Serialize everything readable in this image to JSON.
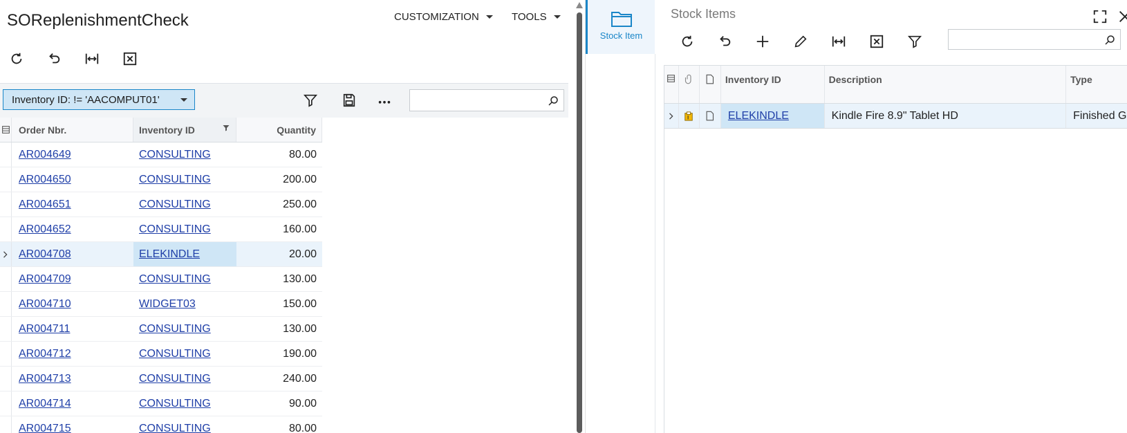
{
  "left": {
    "title": "SOReplenishmentCheck",
    "menus": {
      "customization": "CUSTOMIZATION",
      "tools": "TOOLS"
    },
    "toolbar_icons": [
      "refresh-icon",
      "undo-icon",
      "fit-columns-icon",
      "excel-export-icon"
    ],
    "filter": {
      "chip_label": "Inventory ID: != 'AACOMPUT01'"
    },
    "grid": {
      "columns": {
        "order_nbr": "Order Nbr.",
        "inventory_id": "Inventory ID",
        "quantity": "Quantity"
      },
      "rows": [
        {
          "order_nbr": "AR004649",
          "inventory_id": "CONSULTING",
          "quantity": "80.00"
        },
        {
          "order_nbr": "AR004650",
          "inventory_id": "CONSULTING",
          "quantity": "200.00"
        },
        {
          "order_nbr": "AR004651",
          "inventory_id": "CONSULTING",
          "quantity": "250.00"
        },
        {
          "order_nbr": "AR004652",
          "inventory_id": "CONSULTING",
          "quantity": "160.00"
        },
        {
          "order_nbr": "AR004708",
          "inventory_id": "ELEKINDLE",
          "quantity": "20.00"
        },
        {
          "order_nbr": "AR004709",
          "inventory_id": "CONSULTING",
          "quantity": "130.00"
        },
        {
          "order_nbr": "AR004710",
          "inventory_id": "WIDGET03",
          "quantity": "150.00"
        },
        {
          "order_nbr": "AR004711",
          "inventory_id": "CONSULTING",
          "quantity": "130.00"
        },
        {
          "order_nbr": "AR004712",
          "inventory_id": "CONSULTING",
          "quantity": "190.00"
        },
        {
          "order_nbr": "AR004713",
          "inventory_id": "CONSULTING",
          "quantity": "240.00"
        },
        {
          "order_nbr": "AR004714",
          "inventory_id": "CONSULTING",
          "quantity": "90.00"
        },
        {
          "order_nbr": "AR004715",
          "inventory_id": "CONSULTING",
          "quantity": "80.00"
        }
      ],
      "selected_row_index": 4
    }
  },
  "right": {
    "side_tab_label": "Stock Item",
    "title": "Stock Items",
    "grid": {
      "columns": {
        "inventory_id": "Inventory ID",
        "description": "Description",
        "type": "Type"
      },
      "rows": [
        {
          "inventory_id": "ELEKINDLE",
          "description": "Kindle Fire 8.9\" Tablet HD",
          "type": "Finished G"
        }
      ]
    }
  },
  "colors": {
    "accent": "#1a86c8",
    "selection": "#cfe6f6",
    "link": "#1f3fa8"
  }
}
